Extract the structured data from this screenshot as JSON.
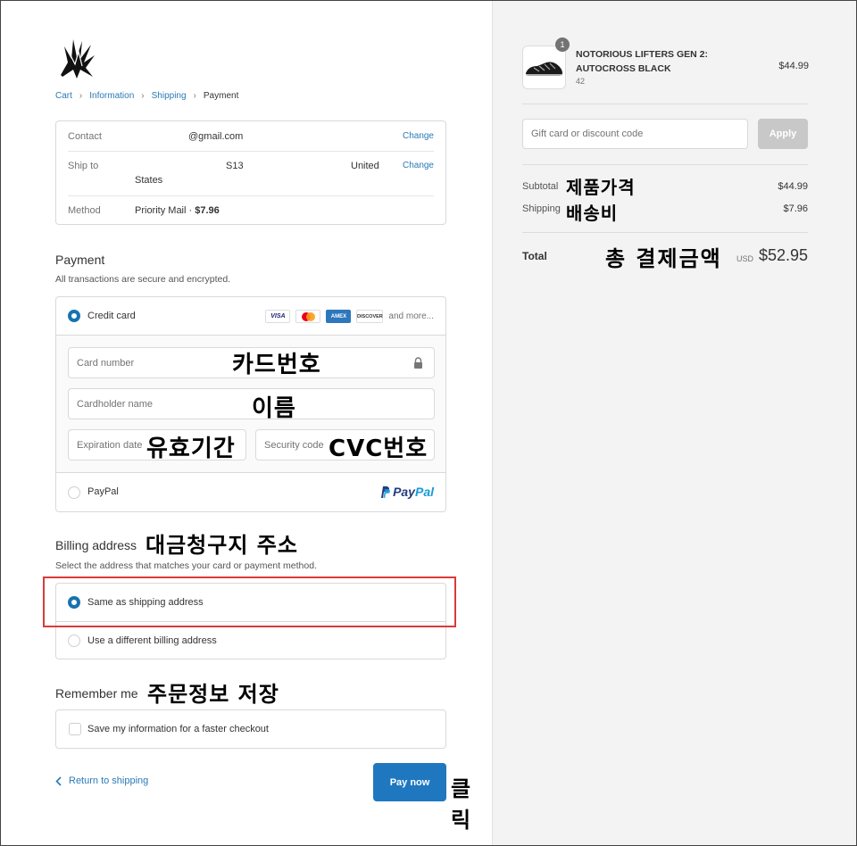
{
  "breadcrumb": {
    "items": [
      "Cart",
      "Information",
      "Shipping"
    ],
    "current": "Payment"
  },
  "info": {
    "contact_label": "Contact",
    "contact_value": "@gmail.com",
    "ship_label": "Ship to",
    "ship_value_1": "S13",
    "ship_value_2": "United",
    "ship_value_3": "States",
    "method_label": "Method",
    "method_value": "Priority Mail · ",
    "method_price": "$7.96",
    "change_label": "Change"
  },
  "payment": {
    "title": "Payment",
    "subtitle": "All transactions are secure and encrypted.",
    "credit_card_label": "Credit card",
    "card_logos": [
      "VISA",
      "AMEX",
      "DISCOVER"
    ],
    "more": "and more...",
    "card_number_ph": "Card number",
    "cardholder_ph": "Cardholder name",
    "expiration_ph": "Expiration date",
    "security_ph": "Security code",
    "paypal_label": "PayPal",
    "paypal_logo_a": "Pay",
    "paypal_logo_b": "Pal"
  },
  "billing": {
    "title": "Billing address",
    "subtitle": "Select the address that matches your card or payment method.",
    "same_label": "Same as shipping address",
    "different_label": "Use a different billing address"
  },
  "remember": {
    "title": "Remember me",
    "checkbox_label": "Save my information for a faster checkout"
  },
  "footer": {
    "return_label": "Return to shipping",
    "pay_label": "Pay now"
  },
  "annotations": {
    "card_number": "카드번호",
    "name": "이름",
    "expiry": "유효기간",
    "cvc": "CVC번호",
    "billing": "대금청구지 주소",
    "remember": "주문정보 저장",
    "click": "클릭",
    "product_price": "제품가격",
    "shipping_fee": "배송비",
    "total": "총 결제금액"
  },
  "order": {
    "qty": "1",
    "product_name": "NOTORIOUS LIFTERS GEN 2: AUTOCROSS BLACK",
    "variant": "42",
    "price": "$44.99",
    "discount_ph": "Gift card or discount code",
    "apply_label": "Apply",
    "subtotal_label": "Subtotal",
    "subtotal": "$44.99",
    "shipping_label": "Shipping",
    "shipping": "$7.96",
    "total_label": "Total",
    "currency": "USD",
    "total": "$52.95"
  },
  "colors": {
    "accent": "#1f78bf",
    "link": "#2a7ab5",
    "highlight": "#d83b3b"
  }
}
